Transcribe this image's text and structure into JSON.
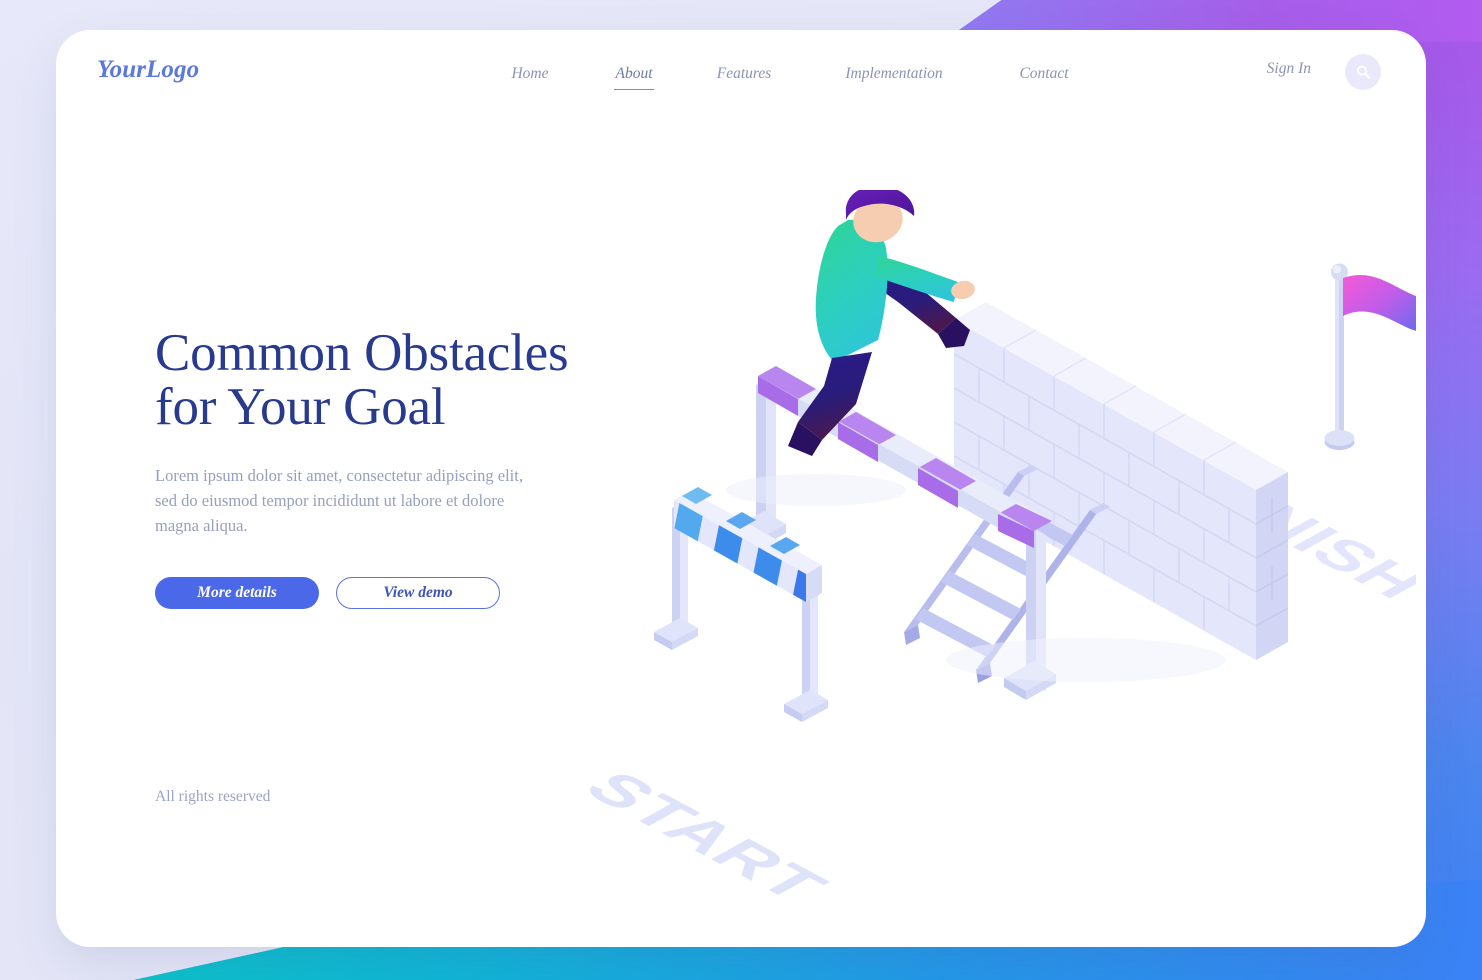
{
  "header": {
    "logo": "YourLogo",
    "nav": [
      {
        "label": "Home",
        "active": false
      },
      {
        "label": "About",
        "active": true
      },
      {
        "label": "Features",
        "active": false
      },
      {
        "label": "Implementation",
        "active": false
      },
      {
        "label": "Contact",
        "active": false
      }
    ],
    "sign_in": "Sign In",
    "search_icon": "search-icon"
  },
  "hero": {
    "title_line1": "Common Obstacles",
    "title_line2": "for Your Goal",
    "paragraph": "Lorem ipsum dolor sit amet, consectetur adipiscing elit, sed do eiusmod tempor incididunt ut labore et dolore magna aliqua.",
    "primary_button": "More details",
    "secondary_button": "View demo"
  },
  "footer": {
    "rights": "All rights reserved"
  },
  "illustration": {
    "start_label": "START",
    "finish_label": "FINISH",
    "elements": [
      "hurdle-striped-blue",
      "hurdle-purple",
      "runner-figure",
      "brick-wall",
      "ladder",
      "finish-flag"
    ]
  },
  "colors": {
    "brand_logo": "#5a78e0",
    "heading": "#283a8e",
    "body_text": "#97a0bd",
    "nav_text": "#8b93b5",
    "primary_button_bg": "#4a68e8",
    "secondary_button_border": "#5a72dd",
    "card_bg": "#ffffff",
    "page_bg": "#e4e6f8",
    "accent_purple": "#a855e8",
    "accent_blue": "#3b82f6",
    "accent_teal": "#06c8c0",
    "illustration_lavender": "#dcdefa",
    "flag_pink": "#f05bd8",
    "flag_purple": "#7b5cf0",
    "runner_jacket": "#2ed6a8",
    "runner_hair": "#5b1fa8"
  }
}
